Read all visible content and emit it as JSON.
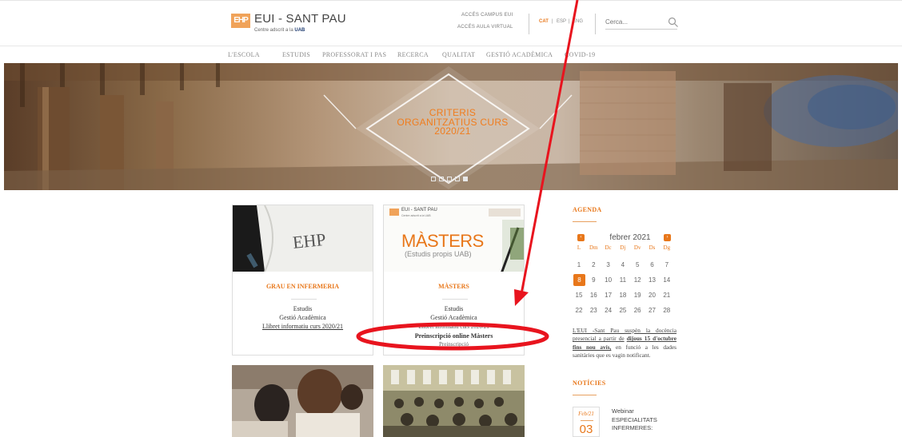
{
  "header": {
    "logo_mark": "EHP",
    "logo_title": "EUI - SANT PAU",
    "logo_sub_prefix": "Centre adscrit a la",
    "logo_sub_brand": "UAB",
    "campus_link": "ACCÉS CAMPUS EUI",
    "aula_link": "ACCÉS AULA VIRTUAL",
    "lang_cat": "CAT",
    "lang_esp": "ESP",
    "lang_eng": "ENG",
    "lang_sep": "|",
    "search_placeholder": "Cerca..."
  },
  "nav": [
    "L'ESCOLA",
    "ESTUDIS",
    "PROFESSORAT I PAS",
    "RECERCA",
    "QUALITAT",
    "GESTIÓ ACADÈMICA",
    "COVID-19"
  ],
  "hero": {
    "caption_1": "CRITERIS",
    "caption_2": "ORGANITZATIUS CURS",
    "caption_3": "2020/21",
    "slide_count": 5,
    "active_slide": 5
  },
  "cards": {
    "grau": {
      "title": "GRAU EN INFERMERIA",
      "link_1": "Estudis",
      "link_2": "Gestió Acadèmica",
      "link_3": "Llibret informatiu curs 2020/21",
      "image_text": "EHP"
    },
    "masters": {
      "title": "MÀSTERS",
      "header_logo": "EUI - SANT PAU",
      "header_logo_sub": "Centre adscrit a la UAB",
      "image_title": "MÀSTERS",
      "image_sub": "(Estudis propis UAB)",
      "link_1": "Estudis",
      "link_2": "Gestió Acadèmica",
      "link_3": "Llibret informatiu curs 2020/21",
      "link_4": "Preinscripció online Màsters",
      "link_5": "Preinscripció"
    }
  },
  "sidebar": {
    "agenda_title": "AGENDA",
    "month": "febrer 2021",
    "prev_icon": "chevron-left",
    "next_icon": "chevron-right",
    "weekdays": [
      "L",
      "Dm",
      "Dc",
      "Dj",
      "Dv",
      "Ds",
      "Dg"
    ],
    "weeks": [
      [
        "1",
        "2",
        "3",
        "4",
        "5",
        "6",
        "7"
      ],
      [
        "8",
        "9",
        "10",
        "11",
        "12",
        "13",
        "14"
      ],
      [
        "15",
        "16",
        "17",
        "18",
        "19",
        "20",
        "21"
      ],
      [
        "22",
        "23",
        "24",
        "25",
        "26",
        "27",
        "28"
      ]
    ],
    "today": "8",
    "notice_1": "L'EUI -Sant Pau suspèn la docència presencial a partir de",
    "notice_2": "dijous 15 d'octubre fins nou avís,",
    "notice_3": "en funció a les dades sanitàries que es vagin notificant.",
    "news_title": "NOTÍCIES",
    "news_month": "Feb/21",
    "news_day": "03",
    "news_text_1": "Webinar",
    "news_text_2": "ESPECIALITATS",
    "news_text_3": "INFERMERES:"
  },
  "colors": {
    "accent": "#e8771a",
    "annotation": "#e8141e"
  }
}
